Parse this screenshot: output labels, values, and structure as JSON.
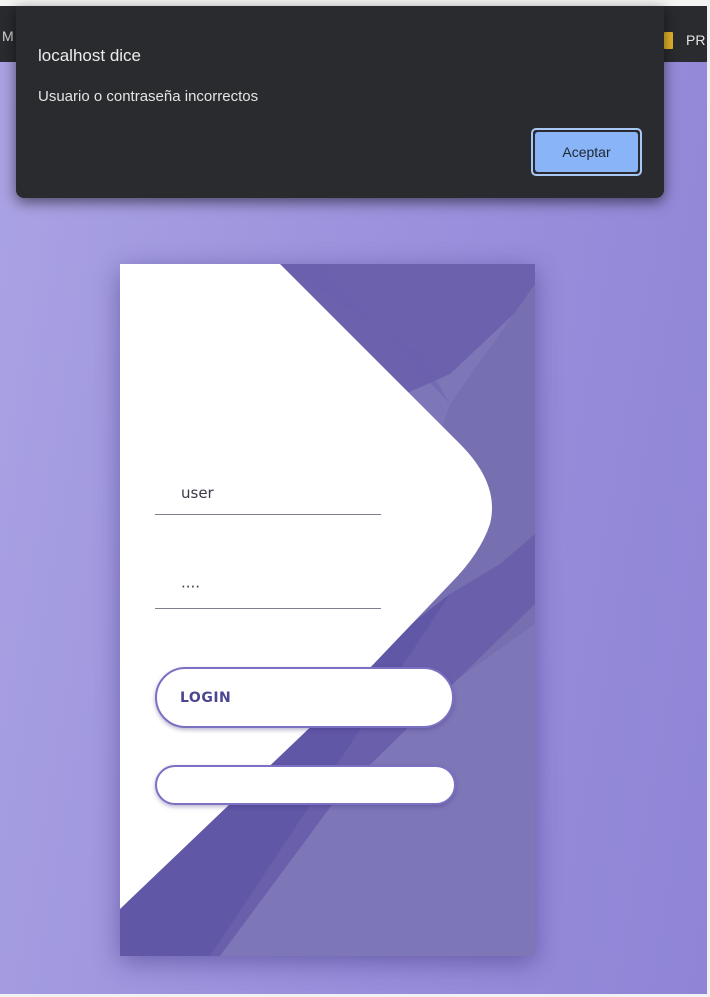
{
  "browser": {
    "left_text": "M",
    "right_text": "PR"
  },
  "dialog": {
    "title": "localhost dice",
    "message": "Usuario o contraseña incorrectos",
    "accept_label": "Aceptar"
  },
  "login": {
    "username_value": "user",
    "password_value": "····",
    "login_label": "LOGIN",
    "second_button_label": ""
  },
  "colors": {
    "background": "#9c92dd",
    "card_purple": "#6a5fb0",
    "dialog_bg": "#2a2b2e",
    "dialog_button": "#8ab4f8"
  }
}
